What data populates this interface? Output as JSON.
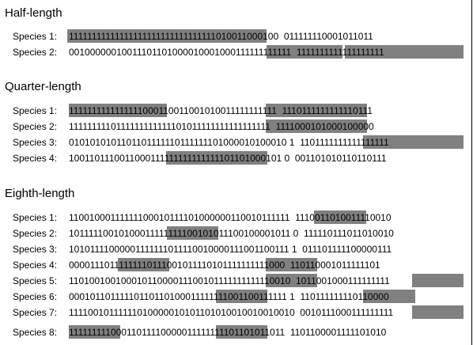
{
  "sections": [
    {
      "title": "Half-length",
      "rows": [
        {
          "label": "Species 1:",
          "sequence": "11111111111111111111111111111111010011000100  011111110001011011",
          "highlights": [
            [
              0,
              32
            ]
          ]
        },
        {
          "label": "Species 2:",
          "sequence": "00100000010011101101000010001000111111111111  1111111111111111111",
          "highlights": [
            [
              32,
              44
            ],
            [
              46,
              65
            ]
          ]
        }
      ]
    },
    {
      "title": "Quarter-length",
      "rows": [
        {
          "label": "Species 1:",
          "sequence": "1111111111111111000110011001010011111111111  1110111111111110111",
          "highlights": [
            [
              0,
              16
            ],
            [
              32,
              47
            ]
          ]
        },
        {
          "label": "Species 2:",
          "sequence": "1111111110111111111111101011111111111111111  1111000101000100000",
          "highlights": [
            [
              32,
              47
            ]
          ]
        },
        {
          "label": "Species 3:",
          "sequence": "0101010101101101111110111111101000010100010 1  1101111111111111111",
          "highlights": [
            [
              48,
              64
            ]
          ]
        },
        {
          "label": "Species 4:",
          "sequence": "1001101110011000111111111111111101101000101 0  001101010110110111",
          "highlights": [
            [
              16,
              32
            ]
          ]
        }
      ]
    },
    {
      "title": "Eighth-length",
      "rows": [
        {
          "label": "Species 1:",
          "sequence": "11001000111111100010111101000000110010111111  1110011010011110010",
          "highlights": [
            [
              40,
              47
            ]
          ]
        },
        {
          "label": "Species 2:",
          "sequence": "10111110010100011111111100101011100100001011 0  111110111011010010",
          "highlights": [
            [
              16,
              24
            ]
          ]
        },
        {
          "label": "Species 3:",
          "sequence": "10101111000001111111011110010000111001100111 1  011101111100000111",
          "highlights": []
        },
        {
          "label": "Species 4:",
          "sequence": "00001110111111110111001011110101111111111000  110110001011111101",
          "highlights": [
            [
              8,
              16
            ],
            [
              32,
              40
            ]
          ]
        },
        {
          "label": "Species 5:",
          "sequence": "11010010010001011000011100101111111111110010  1011001000111111111",
          "highlights": [
            [
              32,
              40
            ],
            [
              56,
              64
            ]
          ]
        },
        {
          "label": "Species 6:",
          "sequence": "00010110111110110110100011111111001100111111 1  110111111110110000",
          "highlights": [
            [
              24,
              32
            ],
            [
              48,
              56
            ]
          ]
        },
        {
          "label": "Species 7:",
          "sequence": "11110010111111010000010101101010010010010010  0010111000111111111",
          "highlights": [
            [
              56,
              64
            ]
          ]
        },
        {
          "label": "Species 8:",
          "sequence": "11111111100011011110000011111111101101011011  1101100001111101010",
          "highlights": [
            [
              0,
              8
            ],
            [
              24,
              32
            ]
          ]
        }
      ]
    }
  ]
}
